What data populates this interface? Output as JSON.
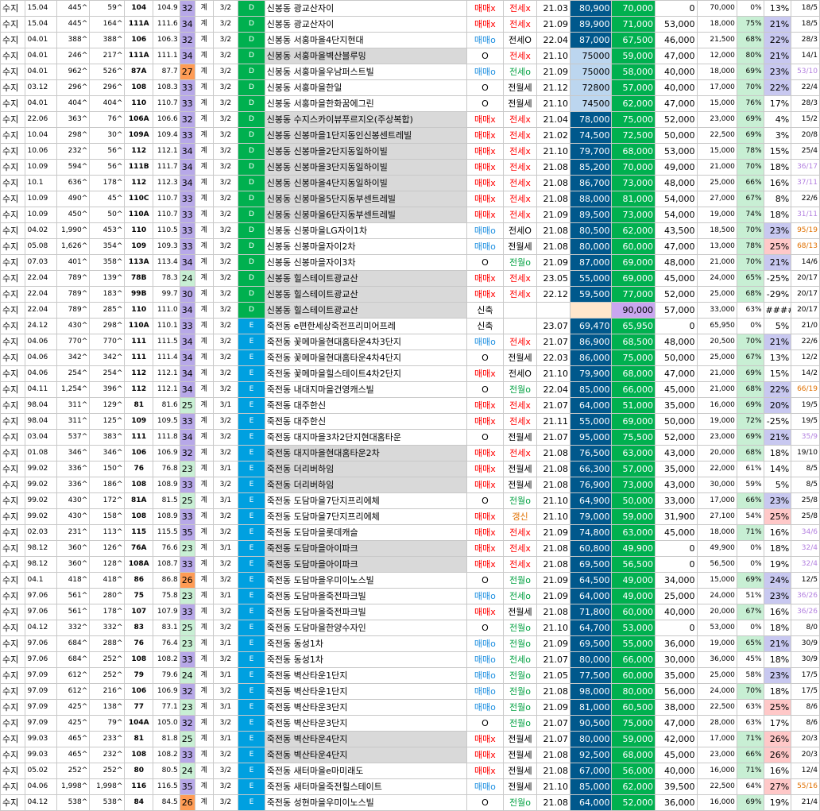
{
  "rows": [
    [
      "수지",
      "15.04",
      "445^",
      "59^",
      "104",
      "104.9",
      "32",
      "계",
      "3/2",
      "D",
      "신봉동 광교산자이",
      "매매x",
      "전세x",
      "21.03",
      "80,900",
      "70,000",
      "0",
      "70,000",
      "0%",
      "13%",
      "18/5"
    ],
    [
      "수지",
      "15.04",
      "445^",
      "164^",
      "111A",
      "111.6",
      "34",
      "계",
      "3/2",
      "D",
      "신봉동 광교산자이",
      "매매x",
      "전세x",
      "21.09",
      "89,900",
      "71,000",
      "53,000",
      "18,000",
      "75%",
      "21%",
      "18/5"
    ],
    [
      "수지",
      "04.01",
      "388^",
      "388^",
      "106",
      "106.3",
      "32",
      "계",
      "3/2",
      "D",
      "신봉동 서홍마을4단지현대",
      "매매o",
      "전세O",
      "22.04",
      "87,000",
      "67,500",
      "46,000",
      "21,500",
      "68%",
      "22%",
      "28/3"
    ],
    [
      "수지",
      "04.01",
      "246^",
      "217^",
      "111A",
      "111.1",
      "34",
      "계",
      "3/2",
      "D",
      "신봉동 서홍마을벽산블루밍",
      "O",
      "전세x",
      "21.10",
      "75000",
      "59,000",
      "47,000",
      "12,000",
      "80%",
      "21%",
      "14/1"
    ],
    [
      "수지",
      "04.01",
      "962^",
      "526^",
      "87A",
      "87.7",
      "27",
      "계",
      "3/2",
      "D",
      "신봉동 서홍마을우남퍼스트빌",
      "매매o",
      "전세o",
      "21.09",
      "75000",
      "58,000",
      "40,000",
      "18,000",
      "69%",
      "23%",
      "53/10"
    ],
    [
      "수지",
      "03.12",
      "296^",
      "296^",
      "108",
      "108.3",
      "33",
      "계",
      "3/2",
      "D",
      "신봉동 서홍마을한일",
      "O",
      "전월세",
      "21.12",
      "72800",
      "57,000",
      "40,000",
      "17,000",
      "70%",
      "22%",
      "22/4"
    ],
    [
      "수지",
      "04.01",
      "404^",
      "404^",
      "110",
      "110.7",
      "33",
      "계",
      "3/2",
      "D",
      "신봉동 서홍마을한화꿈에그린",
      "O",
      "전월세",
      "21.10",
      "74500",
      "62,000",
      "47,000",
      "15,000",
      "76%",
      "17%",
      "28/3"
    ],
    [
      "수지",
      "22.06",
      "363^",
      "76^",
      "106A",
      "106.6",
      "32",
      "계",
      "3/2",
      "D",
      "신봉동 수지스카이뷰푸르지오(주상복합)",
      "매매x",
      "전세x",
      "21.04",
      "78,000",
      "75,000",
      "52,000",
      "23,000",
      "69%",
      "4%",
      "15/2"
    ],
    [
      "수지",
      "10.04",
      "298^",
      "30^",
      "109A",
      "109.4",
      "33",
      "계",
      "3/2",
      "D",
      "신봉동 신봉마을1단지동인신봉센트레빌",
      "매매x",
      "전세x",
      "21.02",
      "74,500",
      "72,500",
      "50,000",
      "22,500",
      "69%",
      "3%",
      "20/8"
    ],
    [
      "수지",
      "10.06",
      "232^",
      "56^",
      "112",
      "112.1",
      "34",
      "계",
      "3/2",
      "D",
      "신봉동 신봉마을2단지동일하이빌",
      "매매x",
      "전세x",
      "21.10",
      "79,700",
      "68,000",
      "53,000",
      "15,000",
      "78%",
      "15%",
      "25/4"
    ],
    [
      "수지",
      "10.09",
      "594^",
      "56^",
      "111B",
      "111.7",
      "34",
      "계",
      "3/2",
      "D",
      "신봉동 신봉마을3단지동일하이빌",
      "매매x",
      "전세x",
      "21.08",
      "85,200",
      "70,000",
      "49,000",
      "21,000",
      "70%",
      "18%",
      "36/17"
    ],
    [
      "수지",
      "10.1",
      "636^",
      "178^",
      "112",
      "112.3",
      "34",
      "계",
      "3/2",
      "D",
      "신봉동 신봉마을4단지동일하이빌",
      "매매x",
      "전세x",
      "21.08",
      "86,700",
      "73,000",
      "48,000",
      "25,000",
      "66%",
      "16%",
      "37/11"
    ],
    [
      "수지",
      "10.09",
      "490^",
      "45^",
      "110C",
      "110.7",
      "33",
      "계",
      "3/2",
      "D",
      "신봉동 신봉마을5단지동부센트레빌",
      "매매x",
      "전세x",
      "21.08",
      "88,000",
      "81,000",
      "54,000",
      "27,000",
      "67%",
      "8%",
      "22/6"
    ],
    [
      "수지",
      "10.09",
      "450^",
      "50^",
      "110A",
      "110.7",
      "33",
      "계",
      "3/2",
      "D",
      "신봉동 신봉마을6단지동부센트레빌",
      "매매x",
      "전세x",
      "21.09",
      "89,500",
      "73,000",
      "54,000",
      "19,000",
      "74%",
      "18%",
      "31/11"
    ],
    [
      "수지",
      "04.02",
      "1,990^",
      "453^",
      "110",
      "110.5",
      "33",
      "계",
      "3/2",
      "D",
      "신봉동 신봉마을LG자이1차",
      "매매o",
      "전세O",
      "21.08",
      "80,500",
      "62,000",
      "43,500",
      "18,500",
      "70%",
      "23%",
      "95/19"
    ],
    [
      "수지",
      "05.08",
      "1,626^",
      "354^",
      "109",
      "109.3",
      "33",
      "계",
      "3/2",
      "D",
      "신봉동 신봉마을자이2차",
      "매매o",
      "전월세",
      "21.08",
      "80,000",
      "60,000",
      "47,000",
      "13,000",
      "78%",
      "25%",
      "68/13"
    ],
    [
      "수지",
      "07.03",
      "401^",
      "358^",
      "113A",
      "113.4",
      "34",
      "계",
      "3/2",
      "D",
      "신봉동 신봉마을자이3차",
      "O",
      "전월o",
      "21.09",
      "87,000",
      "69,000",
      "48,000",
      "21,000",
      "70%",
      "21%",
      "14/6"
    ],
    [
      "수지",
      "22.04",
      "789^",
      "139^",
      "78B",
      "78.3",
      "24",
      "계",
      "3/2",
      "D",
      "신봉동 힐스테이트광교산",
      "매매x",
      "전세x",
      "23.05",
      "55,000",
      "69,000",
      "45,000",
      "24,000",
      "65%",
      "-25%",
      "20/17"
    ],
    [
      "수지",
      "22.04",
      "789^",
      "183^",
      "99B",
      "99.7",
      "30",
      "계",
      "3/2",
      "D",
      "신봉동 힐스테이트광교산",
      "매매x",
      "전세x",
      "22.12",
      "59,500",
      "77,000",
      "52,000",
      "25,000",
      "68%",
      "-29%",
      "20/17"
    ],
    [
      "수지",
      "22.04",
      "789^",
      "285^",
      "110",
      "111.0",
      "34",
      "계",
      "3/2",
      "D",
      "신봉동 힐스테이트광교산",
      "신축",
      "",
      "",
      "",
      "90,000",
      "57,000",
      "33,000",
      "63%",
      "####",
      "20/17"
    ],
    [
      "수지",
      "24.12",
      "430^",
      "298^",
      "110A",
      "110.1",
      "33",
      "계",
      "3/2",
      "E",
      "죽전동 e편한세상죽전프리미어프레",
      "신축",
      "",
      "23.07",
      "69,470",
      "65,950",
      "0",
      "65,950",
      "0%",
      "5%",
      "21/0"
    ],
    [
      "수지",
      "04.06",
      "770^",
      "770^",
      "111",
      "111.5",
      "34",
      "계",
      "3/2",
      "E",
      "죽전동 꽃메마을현대홈타운4차3단지",
      "매매o",
      "전세x",
      "21.07",
      "86,900",
      "68,500",
      "48,000",
      "20,500",
      "70%",
      "21%",
      "22/6"
    ],
    [
      "수지",
      "04.06",
      "342^",
      "342^",
      "111",
      "111.4",
      "34",
      "계",
      "3/2",
      "E",
      "죽전동 꽃메마을현대홈타운4차4단지",
      "O",
      "전월세",
      "22.03",
      "86,000",
      "75,000",
      "50,000",
      "25,000",
      "67%",
      "13%",
      "12/2"
    ],
    [
      "수지",
      "04.06",
      "254^",
      "254^",
      "112",
      "112.1",
      "34",
      "계",
      "3/2",
      "E",
      "죽전동 꽃메마을힐스테이트4차2단지",
      "매매x",
      "전세O",
      "21.10",
      "79,900",
      "68,000",
      "47,000",
      "21,000",
      "69%",
      "15%",
      "14/2"
    ],
    [
      "수지",
      "04.11",
      "1,254^",
      "396^",
      "112",
      "112.1",
      "34",
      "계",
      "3/2",
      "E",
      "죽전동 내대지마을건영캐스빌",
      "O",
      "전월o",
      "22.04",
      "85,000",
      "66,000",
      "45,000",
      "21,000",
      "68%",
      "22%",
      "66/19"
    ],
    [
      "수지",
      "98.04",
      "311^",
      "129^",
      "81",
      "81.6",
      "25",
      "계",
      "3/1",
      "E",
      "죽전동 대주한신",
      "매매x",
      "전세x",
      "21.07",
      "64,000",
      "51,000",
      "35,000",
      "16,000",
      "69%",
      "20%",
      "19/5"
    ],
    [
      "수지",
      "98.04",
      "311^",
      "125^",
      "109",
      "109.5",
      "33",
      "계",
      "3/2",
      "E",
      "죽전동 대주한신",
      "매매x",
      "전세x",
      "21.11",
      "55,000",
      "69,000",
      "50,000",
      "19,000",
      "72%",
      "-25%",
      "19/5"
    ],
    [
      "수지",
      "03.04",
      "537^",
      "383^",
      "111",
      "111.8",
      "34",
      "계",
      "3/2",
      "E",
      "죽전동 대지마을3차2단지현대홈타운",
      "O",
      "전월세",
      "21.07",
      "95,000",
      "75,500",
      "52,000",
      "23,000",
      "69%",
      "21%",
      "35/9"
    ],
    [
      "수지",
      "01.08",
      "346^",
      "346^",
      "106",
      "106.9",
      "32",
      "계",
      "3/2",
      "E",
      "죽전동 대지마을현대홈타운2차",
      "매매x",
      "전세x",
      "21.08",
      "76,500",
      "63,000",
      "43,000",
      "20,000",
      "68%",
      "18%",
      "19/10"
    ],
    [
      "수지",
      "99.02",
      "336^",
      "150^",
      "76",
      "76.8",
      "23",
      "계",
      "3/1",
      "E",
      "죽전동 더리버하임",
      "매매x",
      "전월세",
      "21.08",
      "66,300",
      "57,000",
      "35,000",
      "22,000",
      "61%",
      "14%",
      "8/5"
    ],
    [
      "수지",
      "99.02",
      "336^",
      "186^",
      "108",
      "108.9",
      "33",
      "계",
      "3/2",
      "E",
      "죽전동 더리버하임",
      "매매x",
      "전월세",
      "21.08",
      "76,900",
      "73,000",
      "43,000",
      "30,000",
      "59%",
      "5%",
      "8/5"
    ],
    [
      "수지",
      "99.02",
      "430^",
      "172^",
      "81A",
      "81.5",
      "25",
      "계",
      "3/1",
      "E",
      "죽전동 도담마을7단지프리에체",
      "O",
      "전월o",
      "21.10",
      "64,900",
      "50,000",
      "33,000",
      "17,000",
      "66%",
      "23%",
      "25/8"
    ],
    [
      "수지",
      "99.02",
      "430^",
      "158^",
      "108",
      "108.9",
      "33",
      "계",
      "3/2",
      "E",
      "죽전동 도담마을7단지프리에체",
      "매매x",
      "갱신",
      "21.10",
      "79,000",
      "59,000",
      "31,900",
      "27,100",
      "54%",
      "25%",
      "25/8"
    ],
    [
      "수지",
      "02.03",
      "231^",
      "113^",
      "115",
      "115.5",
      "35",
      "계",
      "3/2",
      "E",
      "죽전동 도담마을롯데캐슬",
      "매매x",
      "전세x",
      "21.09",
      "74,800",
      "63,000",
      "45,000",
      "18,000",
      "71%",
      "16%",
      "34/6"
    ],
    [
      "수지",
      "98.12",
      "360^",
      "126^",
      "76A",
      "76.6",
      "23",
      "계",
      "3/1",
      "E",
      "죽전동 도담마을아이파크",
      "매매x",
      "전세x",
      "21.08",
      "60,800",
      "49,900",
      "0",
      "49,900",
      "0%",
      "18%",
      "32/4"
    ],
    [
      "수지",
      "98.12",
      "360^",
      "128^",
      "108A",
      "108.7",
      "33",
      "계",
      "3/2",
      "E",
      "죽전동 도담마을아이파크",
      "매매x",
      "전세x",
      "21.08",
      "69,500",
      "56,500",
      "0",
      "56,500",
      "0%",
      "19%",
      "32/4"
    ],
    [
      "수지",
      "04.1",
      "418^",
      "418^",
      "86",
      "86.8",
      "26",
      "계",
      "3/2",
      "E",
      "죽전동 도담마을우미이노스빌",
      "O",
      "전월o",
      "21.09",
      "64,500",
      "49,000",
      "34,000",
      "15,000",
      "69%",
      "24%",
      "12/5"
    ],
    [
      "수지",
      "97.06",
      "561^",
      "280^",
      "75",
      "75.8",
      "23",
      "계",
      "3/1",
      "E",
      "죽전동 도담마을죽전파크빌",
      "매매o",
      "전세o",
      "21.09",
      "64,000",
      "49,000",
      "25,000",
      "24,000",
      "51%",
      "23%",
      "36/26"
    ],
    [
      "수지",
      "97.06",
      "561^",
      "178^",
      "107",
      "107.9",
      "33",
      "계",
      "3/2",
      "E",
      "죽전동 도담마을죽전파크빌",
      "매매x",
      "전월세",
      "21.08",
      "71,800",
      "60,000",
      "40,000",
      "20,000",
      "67%",
      "16%",
      "36/26"
    ],
    [
      "수지",
      "04.12",
      "332^",
      "332^",
      "83",
      "83.1",
      "25",
      "계",
      "3/2",
      "E",
      "죽전동 도담마을한양수자인",
      "O",
      "전월o",
      "21.10",
      "64,700",
      "53,000",
      "0",
      "53,000",
      "0%",
      "18%",
      "8/0"
    ],
    [
      "수지",
      "97.06",
      "684^",
      "288^",
      "76",
      "76.4",
      "23",
      "계",
      "3/1",
      "E",
      "죽전동 동성1차",
      "매매o",
      "전월o",
      "21.09",
      "69,500",
      "55,000",
      "36,000",
      "19,000",
      "65%",
      "21%",
      "30/9"
    ],
    [
      "수지",
      "97.06",
      "684^",
      "252^",
      "108",
      "108.2",
      "33",
      "계",
      "3/2",
      "E",
      "죽전동 동성1차",
      "매매o",
      "전세o",
      "21.07",
      "80,000",
      "66,000",
      "30,000",
      "36,000",
      "45%",
      "18%",
      "30/9"
    ],
    [
      "수지",
      "97.09",
      "612^",
      "252^",
      "79",
      "79.6",
      "24",
      "계",
      "3/1",
      "E",
      "죽전동 벽산타운1단지",
      "매매o",
      "전월o",
      "21.05",
      "77,500",
      "60,000",
      "35,000",
      "25,000",
      "58%",
      "23%",
      "17/5"
    ],
    [
      "수지",
      "97.09",
      "612^",
      "216^",
      "106",
      "106.9",
      "32",
      "계",
      "3/2",
      "E",
      "죽전동 벽산타운1단지",
      "매매o",
      "전월o",
      "21.08",
      "98,000",
      "80,000",
      "56,000",
      "24,000",
      "70%",
      "18%",
      "17/5"
    ],
    [
      "수지",
      "97.09",
      "425^",
      "138^",
      "77",
      "77.1",
      "23",
      "계",
      "3/1",
      "E",
      "죽전동 벽산타운3단지",
      "매매o",
      "전월o",
      "21.09",
      "81,000",
      "60,500",
      "38,000",
      "22,500",
      "63%",
      "25%",
      "8/6"
    ],
    [
      "수지",
      "97.09",
      "425^",
      "79^",
      "104A",
      "105.0",
      "32",
      "계",
      "3/2",
      "E",
      "죽전동 벽산타운3단지",
      "O",
      "전월o",
      "21.07",
      "90,500",
      "75,000",
      "47,000",
      "28,000",
      "63%",
      "17%",
      "8/6"
    ],
    [
      "수지",
      "99.03",
      "465^",
      "233^",
      "81",
      "81.8",
      "25",
      "계",
      "3/1",
      "E",
      "죽전동 벽산타운4단지",
      "매매x",
      "전월세",
      "21.07",
      "80,000",
      "59,000",
      "42,000",
      "17,000",
      "71%",
      "26%",
      "20/3"
    ],
    [
      "수지",
      "99.03",
      "465^",
      "232^",
      "108",
      "108.2",
      "33",
      "계",
      "3/2",
      "E",
      "죽전동 벽산타운4단지",
      "매매x",
      "전월세",
      "21.08",
      "92,500",
      "68,000",
      "45,000",
      "23,000",
      "66%",
      "26%",
      "20/3"
    ],
    [
      "수지",
      "05.02",
      "252^",
      "252^",
      "80",
      "80.5",
      "24",
      "계",
      "3/2",
      "E",
      "죽전동 새터마을e마미래도",
      "매매x",
      "전월세",
      "21.08",
      "67,000",
      "56,000",
      "40,000",
      "16,000",
      "71%",
      "16%",
      "12/4"
    ],
    [
      "수지",
      "04.06",
      "1,998^",
      "1,998^",
      "116",
      "116.5",
      "35",
      "계",
      "3/2",
      "E",
      "죽전동 새터마을죽전힐스테이트",
      "매매o",
      "전월세",
      "21.10",
      "85,000",
      "62,000",
      "39,500",
      "22,500",
      "64%",
      "27%",
      "55/16"
    ],
    [
      "수지",
      "04.12",
      "538^",
      "538^",
      "84",
      "84.5",
      "26",
      "계",
      "3/2",
      "E",
      "죽전동 성현마을우미이노스빌",
      "O",
      "전월o",
      "21.08",
      "64,000",
      "52,000",
      "36,000",
      "16,000",
      "69%",
      "19%",
      "21/4"
    ]
  ]
}
